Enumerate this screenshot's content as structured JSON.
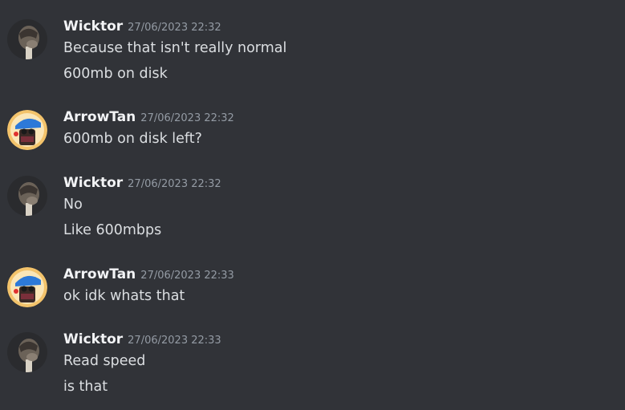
{
  "messages": [
    {
      "author": "Wicktor",
      "avatar": "wicktor-avatar",
      "timestamp": "27/06/2023 22:32",
      "lines": [
        "Because that isn't really normal",
        "600mb on disk"
      ]
    },
    {
      "author": "ArrowTan",
      "avatar": "arrowtan-avatar",
      "timestamp": "27/06/2023 22:32",
      "lines": [
        "600mb on disk left?"
      ]
    },
    {
      "author": "Wicktor",
      "avatar": "wicktor-avatar",
      "timestamp": "27/06/2023 22:32",
      "lines": [
        "No",
        "Like 600mbps"
      ]
    },
    {
      "author": "ArrowTan",
      "avatar": "arrowtan-avatar",
      "timestamp": "27/06/2023 22:33",
      "lines": [
        "ok idk whats that"
      ]
    },
    {
      "author": "Wicktor",
      "avatar": "wicktor-avatar",
      "timestamp": "27/06/2023 22:33",
      "lines": [
        "Read speed",
        "is that"
      ]
    }
  ],
  "colors": {
    "background": "#313338",
    "username": "#f2f3f5",
    "timestamp": "#949ba4",
    "message_text": "#dbdee1"
  }
}
